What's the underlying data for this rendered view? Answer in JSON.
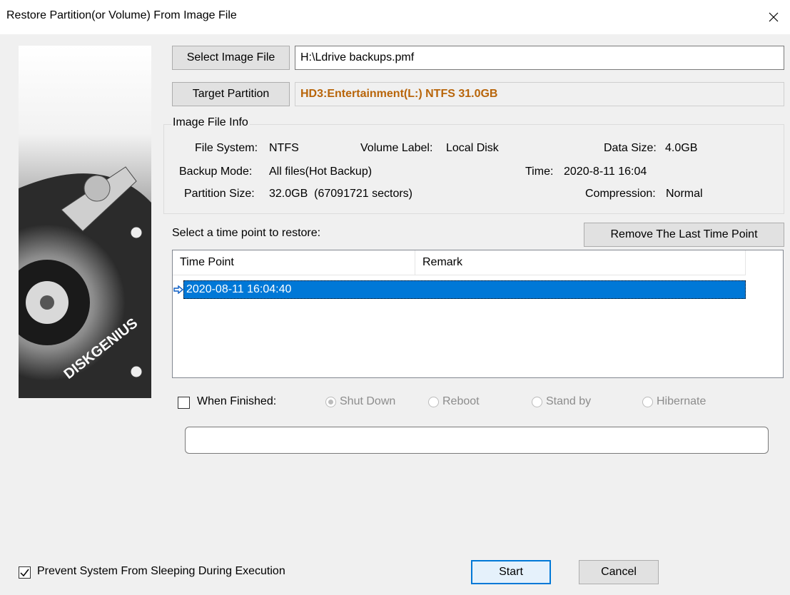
{
  "window": {
    "title": "Restore Partition(or Volume) From Image File"
  },
  "image_file": {
    "button_label": "Select Image File",
    "path": "H:\\Ldrive backups.pmf"
  },
  "target": {
    "button_label": "Target Partition",
    "value": "HD3:Entertainment(L:) NTFS 31.0GB",
    "value_color": "#b8650a"
  },
  "image_info": {
    "title": "Image File Info",
    "file_system_label": "File System:",
    "file_system": "NTFS",
    "volume_label_label": "Volume Label:",
    "volume_label": "Local Disk",
    "data_size_label": "Data Size:",
    "data_size": "4.0GB",
    "backup_mode_label": "Backup Mode:",
    "backup_mode": "All files(Hot Backup)",
    "time_label": "Time:",
    "time": "2020-8-11 16:04",
    "partition_size_label": "Partition Size:",
    "partition_size": "32.0GB  (67091721 sectors)",
    "compression_label": "Compression:",
    "compression": "Normal"
  },
  "timepoints": {
    "prompt": "Select a time point to restore:",
    "remove_button": "Remove The Last Time Point",
    "columns": [
      "Time Point",
      "Remark"
    ],
    "rows": [
      {
        "time_point": "2020-08-11 16:04:40",
        "remark": "",
        "selected": true
      }
    ]
  },
  "when_finished": {
    "label": "When Finished:",
    "checked": false,
    "options": [
      "Shut Down",
      "Reboot",
      "Stand by",
      "Hibernate"
    ],
    "selected": "Shut Down"
  },
  "footer": {
    "prevent_sleep_label": "Prevent System From Sleeping During Execution",
    "prevent_sleep_checked": true,
    "start_label": "Start",
    "cancel_label": "Cancel"
  },
  "branding": {
    "logo_text": "DISKGENIUS"
  },
  "colors": {
    "selection": "#0078d7",
    "accent_orange": "#b8650a",
    "window_bg": "#f0f0f0"
  }
}
